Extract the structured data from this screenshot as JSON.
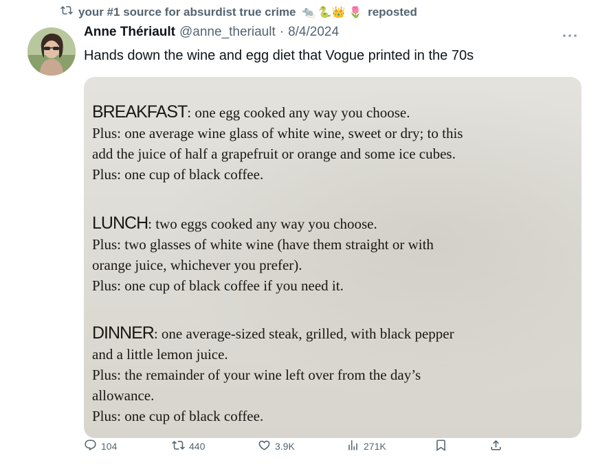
{
  "repost": {
    "account": "your #1 source for absurdist true crime",
    "emojis": "🐀 🐍👑 🌷",
    "label": "reposted"
  },
  "author": {
    "display_name": "Anne Thériault",
    "handle": "@anne_theriault",
    "separator": "·",
    "date": "8/4/2024"
  },
  "tweet": {
    "text": "Hands down the wine and egg diet that Vogue printed in the 70s"
  },
  "media": {
    "breakfast": {
      "heading": "BREAKFAST",
      "lines": [
        ": one egg cooked any way you choose.",
        "Plus: one average wine glass of white wine, sweet or dry; to this",
        "add the juice of half a grapefruit or orange and some ice cubes.",
        "Plus: one cup of black coffee."
      ]
    },
    "lunch": {
      "heading": "LUNCH",
      "lines": [
        ": two eggs cooked any way you choose.",
        "Plus: two glasses of white wine (have them straight or with",
        "orange juice, whichever you prefer).",
        "Plus: one cup of black coffee if you need it."
      ]
    },
    "dinner": {
      "heading": "DINNER",
      "lines": [
        ": one average-sized steak, grilled, with black pepper",
        "and a little lemon juice.",
        "Plus: the remainder of your wine left over from the day’s",
        "allowance.",
        "Plus: one cup of black coffee."
      ]
    }
  },
  "actions": {
    "replies": "104",
    "reposts": "440",
    "likes": "3.9K",
    "views": "271K"
  },
  "icons": {
    "repost": "repost-icon",
    "reply": "reply-icon",
    "like": "heart-icon",
    "views": "views-icon",
    "bookmark": "bookmark-icon",
    "share": "share-icon",
    "more": "more-icon"
  },
  "colors": {
    "secondary_text": "#536471",
    "primary_text": "#0f1419",
    "paper": "#e0ded8"
  }
}
